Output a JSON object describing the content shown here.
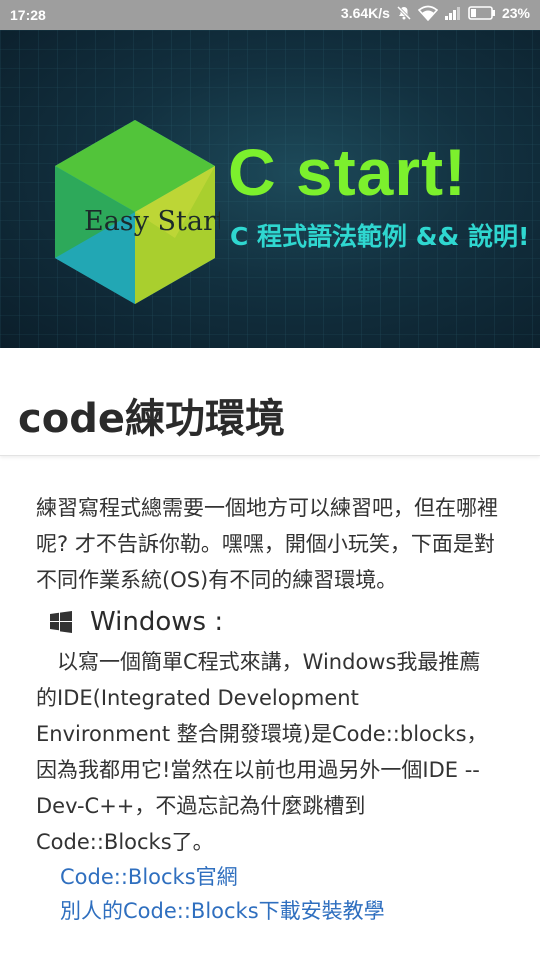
{
  "status_bar": {
    "time": "17:28",
    "net_speed": "3.64K/s",
    "battery": "23%",
    "icons": [
      "mute-icon",
      "wifi-icon",
      "signal-icon",
      "battery-icon"
    ]
  },
  "hero": {
    "logo_text": "Easy Start",
    "title": "C start!",
    "subtitle": "C 程式語法範例 && 說明!",
    "colors": {
      "title": "#7cf02d",
      "subtitle": "#2fd7d0"
    }
  },
  "page": {
    "title": "code練功環境"
  },
  "article": {
    "intro": "練習寫程式總需要一個地方可以練習吧，但在哪裡呢? 才不告訴你勒。嘿嘿，開個小玩笑，下面是對不同作業系統(OS)有不同的練習環境。",
    "windows_heading": "Windows :",
    "windows_icon": "windows-logo-icon",
    "windows_para": "以寫一個簡單C程式來講，Windows我最推薦的IDE(Integrated Development Environment 整合開發環境)是Code::blocks，因為我都用它!當然在以前也用過另外一個IDE -- Dev-C++，不過忘記為什麼跳槽到Code::Blocks了。",
    "links": [
      "Code::Blocks官網",
      "別人的Code::Blocks下載安裝教學"
    ],
    "link_color": "#2f6fbf"
  }
}
